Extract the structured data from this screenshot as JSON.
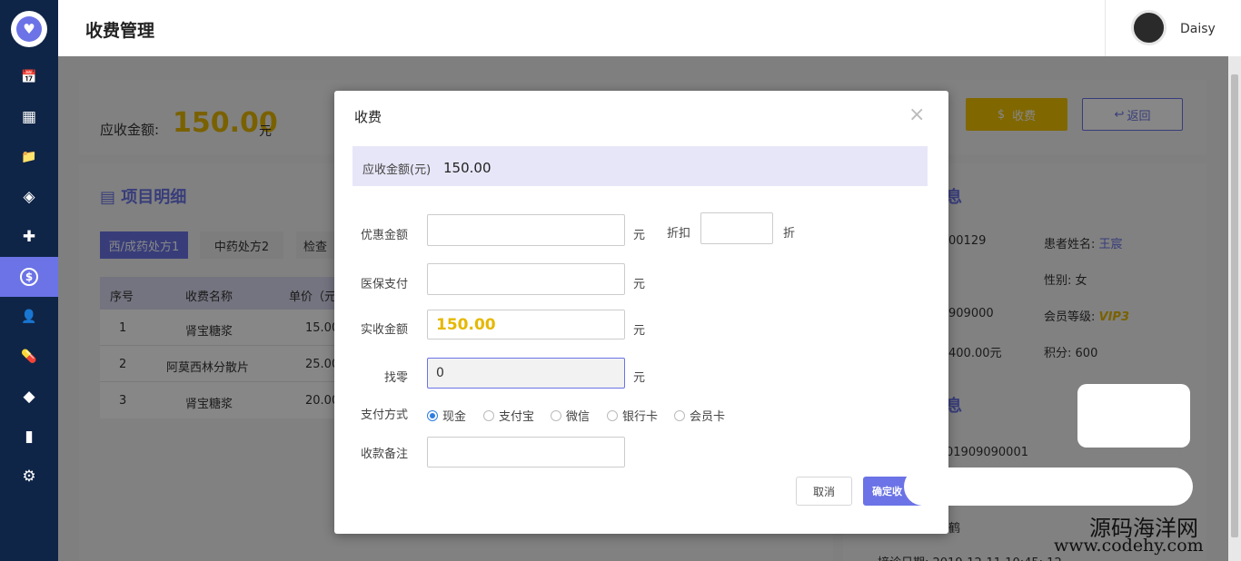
{
  "sidebar": {
    "logo_icon": "♥",
    "items": [
      {
        "name": "calendar-icon",
        "glyph": "📅"
      },
      {
        "name": "dashboard-icon",
        "glyph": "▦"
      },
      {
        "name": "folder-add-icon",
        "glyph": "📁"
      },
      {
        "name": "diamond-route-icon",
        "glyph": "◈"
      },
      {
        "name": "medkit-icon",
        "glyph": "✚"
      },
      {
        "name": "dollar-icon",
        "glyph": "$"
      },
      {
        "name": "contact-card-icon",
        "glyph": "👤"
      },
      {
        "name": "pill-icon",
        "glyph": "💊"
      },
      {
        "name": "gem-icon",
        "glyph": "◆"
      },
      {
        "name": "bar-chart-icon",
        "glyph": "▮"
      },
      {
        "name": "gear-icon",
        "glyph": "⚙"
      }
    ],
    "active_index": 5
  },
  "header": {
    "title": "收费管理",
    "user_name": "Daisy"
  },
  "background": {
    "receivable_label": "应收金额:",
    "receivable_value": "150.00",
    "receivable_unit": "元",
    "charge_button": "收费",
    "back_button": "返回",
    "section_title": "项目明细",
    "tabs": [
      "西/成药处方1",
      "中药处方2",
      "检查"
    ],
    "table_headers": [
      "序号",
      "收费名称",
      "单价（元"
    ],
    "rows": [
      [
        "1",
        "肾宝糖浆",
        "15.00"
      ],
      [
        "2",
        "阿莫西林分散片",
        "25.00"
      ],
      [
        "3",
        "肾宝糖浆",
        "20.00"
      ]
    ],
    "info_title_1": "息",
    "info_title_2": "息",
    "info_left": [
      "00129",
      "",
      "909000",
      "400.00元"
    ],
    "info_right": [
      {
        "label": "患者姓名:",
        "value": "王宸"
      },
      {
        "label": "性别:",
        "value": "女"
      },
      {
        "label": "会员等级:",
        "value": "VIP3"
      },
      {
        "label": "积分:",
        "value": "600"
      }
    ],
    "order_no": "01909090001",
    "doctor_partial": "鹤",
    "visit_date_partial": "接诊日期: 2019-12-11 10:45: 12"
  },
  "modal": {
    "title": "收费",
    "close": "×",
    "amount_label": "应收金额(元)",
    "amount_value": "150.00",
    "discount_amount_label": "优惠金额",
    "discount_amount_value": "",
    "discount_amount_unit": "元",
    "discount_rate_label": "折扣",
    "discount_rate_value": "",
    "discount_rate_unit": "折",
    "insurance_label": "医保支付",
    "insurance_value": "",
    "insurance_unit": "元",
    "actual_label": "实收金额",
    "actual_value": "150.00",
    "actual_unit": "元",
    "change_label": "找零",
    "change_value": "0",
    "change_unit": "元",
    "payment_label": "支付方式",
    "payment_options": [
      "现金",
      "支付宝",
      "微信",
      "银行卡",
      "会员卡"
    ],
    "payment_selected": 0,
    "remark_label": "收款备注",
    "remark_value": "",
    "cancel_button": "取消",
    "confirm_button": "确定收"
  },
  "watermark": {
    "line1": "源码海洋网",
    "line2": "www.codehy.com"
  },
  "colors": {
    "sidebar": "#0f2547",
    "accent": "#6b73e6",
    "gold": "#e6b800",
    "radio": "#2f7de1"
  }
}
